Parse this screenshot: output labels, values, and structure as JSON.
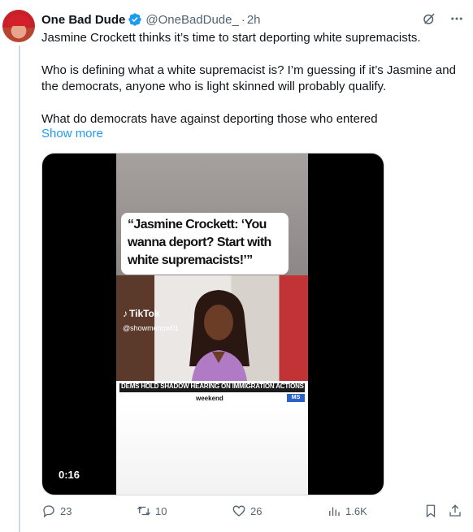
{
  "tweet": {
    "author_name": "One Bad Dude",
    "handle": "@OneBadDude_",
    "separator": "·",
    "time": "2h",
    "paragraphs": [
      "Jasmine Crockett thinks it’s time to start deporting white supremacists.",
      "Who is defining what a white supremacist is?  I’m guessing if it’s Jasmine and the democrats, anyone who is light skinned will probably qualify.",
      "What do democrats have against deporting those who entered"
    ],
    "show_more": "Show more"
  },
  "media": {
    "caption": "“Jasmine Crockett: ‘You wanna deport? Start with white supremacists!’”",
    "watermark_brand": "TikTok",
    "watermark_user": "@showmenow01",
    "chyron": "DEMS HOLD SHADOW HEARING ON IMMIGRATION ACTIONS IN L.A.",
    "network": "weekend",
    "network_badge": "MS",
    "duration": "0:16"
  },
  "actions": {
    "replies": "23",
    "reposts": "10",
    "likes": "26",
    "views": "1.6K"
  },
  "colors": {
    "accent": "#1d9bf0",
    "secondary_text": "#536471",
    "verified": "#1d9bf0"
  },
  "icons": {
    "verified": "verified-badge-icon",
    "grok": "grok-icon",
    "more": "more-icon",
    "reply": "reply-icon",
    "repost": "repost-icon",
    "like": "like-icon",
    "views": "views-icon",
    "bookmark": "bookmark-icon",
    "share": "share-icon"
  }
}
